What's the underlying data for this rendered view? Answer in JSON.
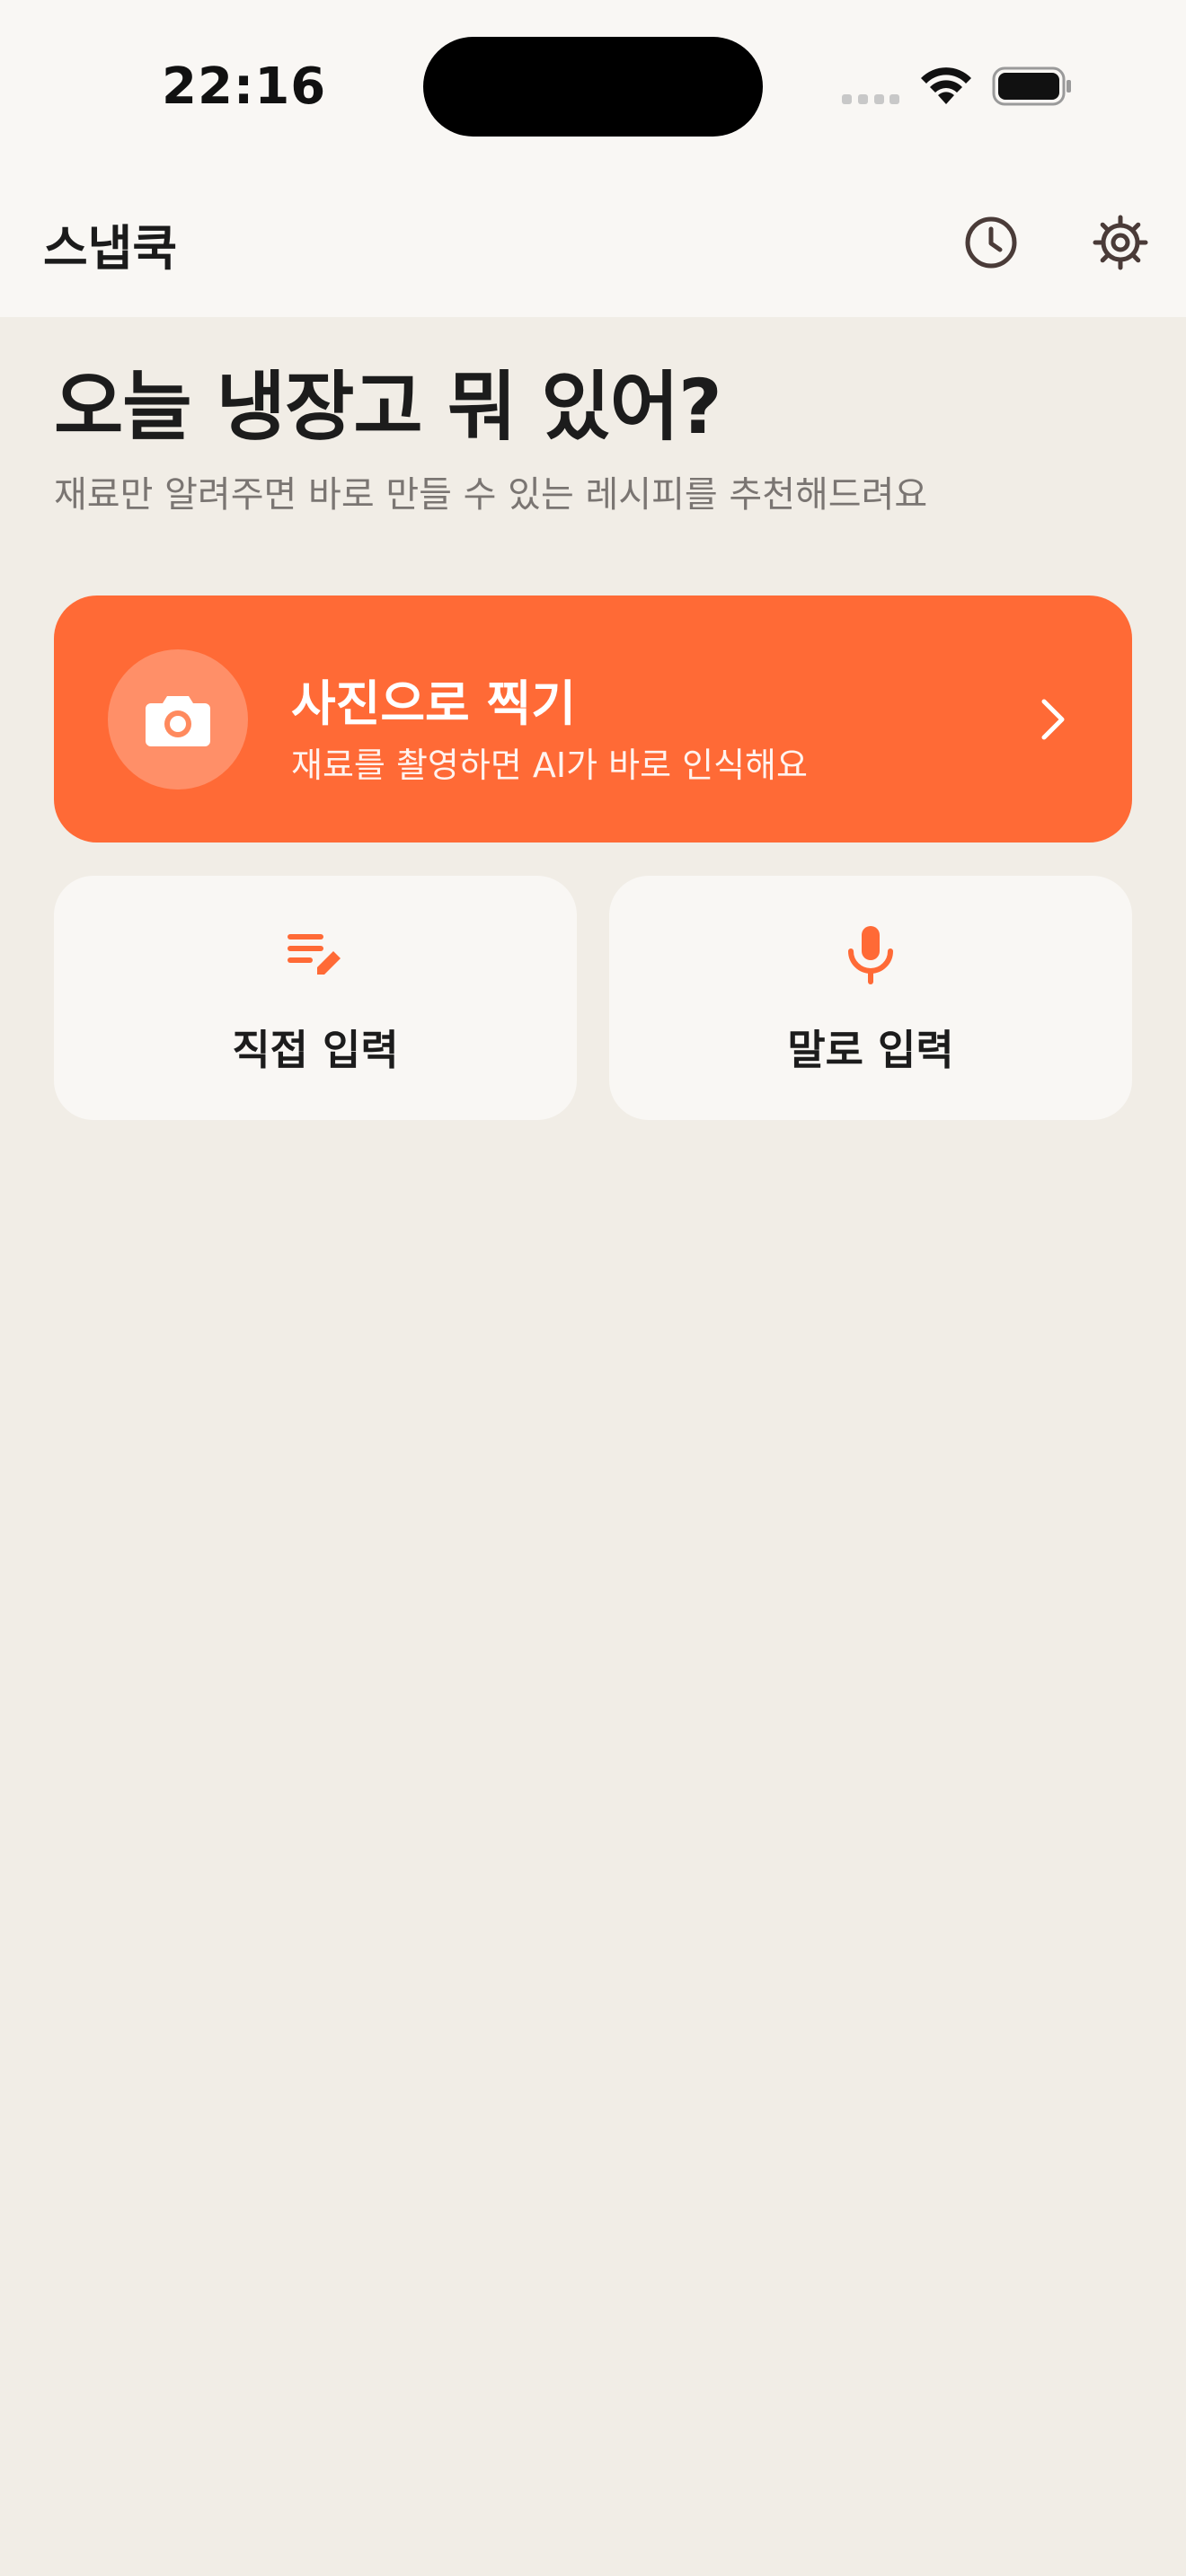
{
  "status_bar": {
    "time": "22:16"
  },
  "header": {
    "app_title": "스냅쿡",
    "history_icon": "clock-icon",
    "settings_icon": "gear-icon"
  },
  "hero": {
    "headline": "오늘 냉장고 뭐 있어?",
    "subline": "재료만 알려주면 바로 만들 수 있는 레시피를 추천해드려요"
  },
  "photo_card": {
    "icon": "camera-icon",
    "title": "사진으로 찍기",
    "subtitle": "재료를 촬영하면 AI가 바로 인식해요",
    "chevron": "chevron-right-icon"
  },
  "options": {
    "manual": {
      "icon": "edit-list-icon",
      "label": "직접 입력"
    },
    "voice": {
      "icon": "microphone-icon",
      "label": "말로 입력"
    }
  },
  "colors": {
    "accent": "#FF6A36",
    "background": "#F1EDE6",
    "surface": "#F9F7F4",
    "text_primary": "#1C1C1C",
    "text_secondary": "#7A7572",
    "icon_dark": "#4A3B38"
  }
}
